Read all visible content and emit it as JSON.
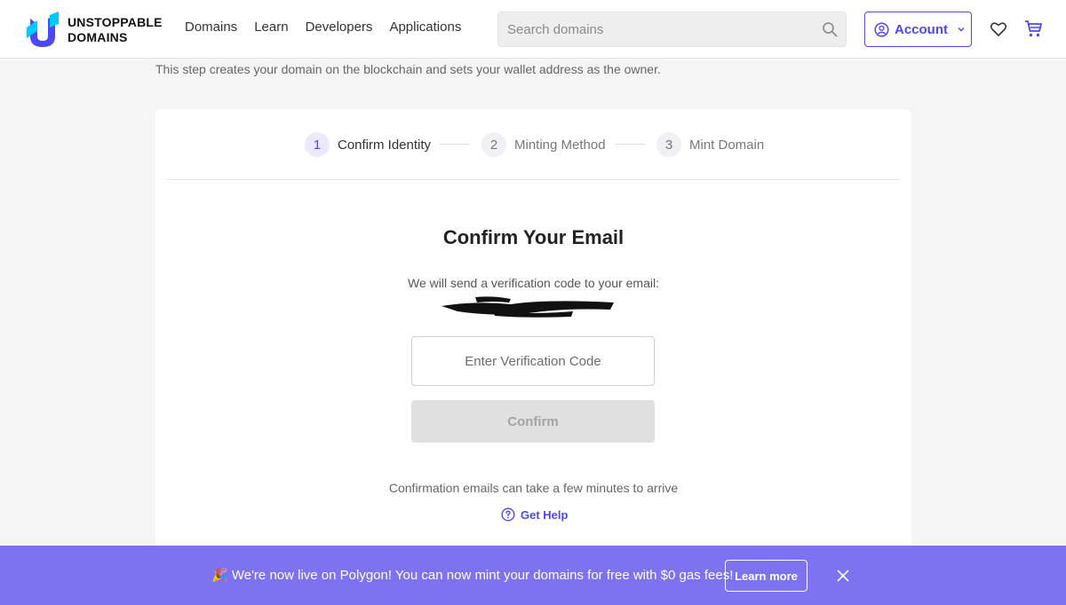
{
  "header": {
    "logo_line1": "UNSTOPPABLE",
    "logo_line2": "DOMAINS",
    "nav": [
      "Domains",
      "Learn",
      "Developers",
      "Applications"
    ],
    "search_placeholder": "Search domains",
    "account_label": "Account"
  },
  "intro": "This step creates your domain on the blockchain and sets your wallet address as the owner.",
  "stepper": {
    "steps": [
      {
        "num": "1",
        "label": "Confirm Identity"
      },
      {
        "num": "2",
        "label": "Minting Method"
      },
      {
        "num": "3",
        "label": "Mint Domain"
      }
    ],
    "active_step": 1
  },
  "form": {
    "title": "Confirm Your Email",
    "description": "We will send a verification code to your email:",
    "code_placeholder": "Enter Verification Code",
    "confirm_label": "Confirm",
    "note": "Confirmation emails can take a few minutes to arrive",
    "help_label": "Get Help"
  },
  "banner": {
    "text": "🎉 We're now live on Polygon! You can now mint your domains for free with $0 gas fees!",
    "learn_more": "Learn more"
  },
  "colors": {
    "accent": "#4c47f7",
    "banner": "#7d72f0"
  }
}
